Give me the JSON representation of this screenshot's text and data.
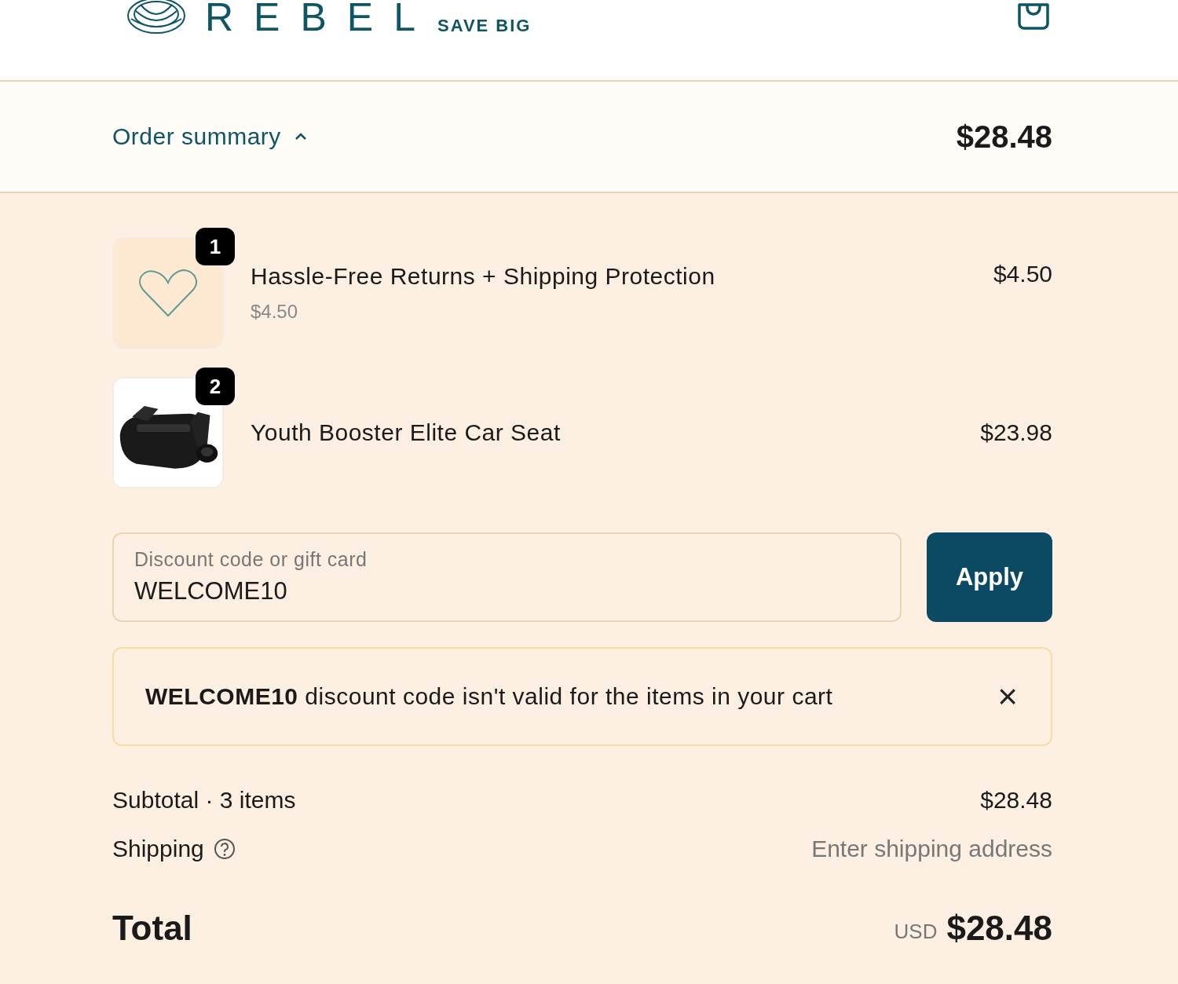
{
  "header": {
    "brand": "REBEL",
    "tagline": "SAVE BIG"
  },
  "summary_bar": {
    "label": "Order summary",
    "expanded": true,
    "total": "$28.48"
  },
  "items": [
    {
      "kind": "icon",
      "quantity": "1",
      "name": "Hassle-Free Returns + Shipping Protection",
      "unit_price": "$4.50",
      "price": "$4.50"
    },
    {
      "kind": "picture",
      "quantity": "2",
      "name": "Youth Booster Elite Car Seat",
      "price": "$23.98"
    }
  ],
  "discount": {
    "placeholder": "Discount code or gift card",
    "value": "WELCOME10",
    "button": "Apply"
  },
  "alert": {
    "message": "**WELCOME10** discount code isn't valid for the items in your cart",
    "close": "×"
  },
  "totals": {
    "subtotal_label": "Subtotal · 3 items",
    "subtotal": "$28.48",
    "shipping_label": "Shipping",
    "shipping": "Enter shipping address",
    "total_label": "Total",
    "currency": "USD",
    "total": "$28.48"
  }
}
